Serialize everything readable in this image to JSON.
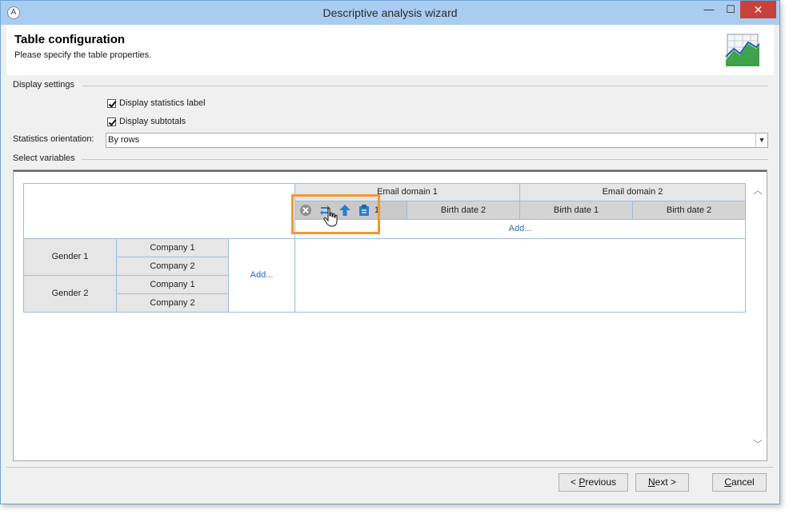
{
  "window": {
    "title": "Descriptive analysis wizard",
    "app_icon": "A"
  },
  "controls": {
    "minimize": "—",
    "maximize": "☐",
    "close": "✕"
  },
  "header": {
    "title": "Table configuration",
    "subtitle": "Please specify the table properties.",
    "icon": "chart-icon"
  },
  "display_settings": {
    "label": "Display settings",
    "statistics_label": {
      "label": "Display statistics label",
      "checked": true
    },
    "subtotals": {
      "label": "Display subtotals",
      "checked": true
    }
  },
  "orientation": {
    "label": "Statistics orientation:",
    "value": "By rows"
  },
  "select_variables": {
    "label": "Select variables",
    "columns": {
      "level1": [
        "Email domain 1",
        "Email domain 2"
      ],
      "level2_first_visible": "1",
      "level2": [
        "Birth date 2",
        "Birth date 1",
        "Birth date 2"
      ],
      "add_label": "Add..."
    },
    "rows": {
      "groups": [
        {
          "label": "Gender 1",
          "children": [
            "Company 1",
            "Company 2"
          ]
        },
        {
          "label": "Gender 2",
          "children": [
            "Company 1",
            "Company 2"
          ]
        }
      ],
      "add_label": "Add..."
    }
  },
  "toolbar_icons": [
    "remove-icon",
    "swap-icon",
    "move-up-icon",
    "clipboard-icon"
  ],
  "buttons": {
    "previous_prefix": "< ",
    "previous_accel": "P",
    "previous_rest": "revious",
    "next_accel": "N",
    "next_rest": "ext >",
    "cancel_accel": "C",
    "cancel_rest": "ancel"
  },
  "colors": {
    "titlebar": "#a9cdf0",
    "accent_highlight": "#f2992e",
    "link": "#2b6cb8",
    "close": "#c7423a"
  }
}
